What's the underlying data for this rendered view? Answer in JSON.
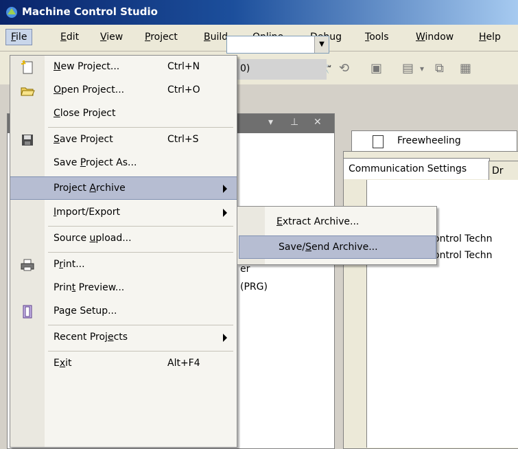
{
  "window": {
    "title": "Machine Control Studio"
  },
  "menubar": {
    "items": [
      {
        "label_u": "F",
        "label_rest": "ile"
      },
      {
        "label_u": "E",
        "label_rest": "dit"
      },
      {
        "label_u": "V",
        "label_rest": "iew"
      },
      {
        "label_u": "P",
        "label_rest": "roject"
      },
      {
        "label_u": "B",
        "label_rest": "uild"
      },
      {
        "label_u": "O",
        "label_rest": "nline"
      },
      {
        "label_u": "D",
        "label_rest": "ebug"
      },
      {
        "label_u": "T",
        "label_rest": "ools"
      },
      {
        "label_u": "W",
        "label_rest": "indow"
      },
      {
        "label_u": "H",
        "label_rest": "elp"
      }
    ]
  },
  "file_menu": {
    "new_project": {
      "u": "N",
      "rest": "ew Project...",
      "shortcut": "Ctrl+N"
    },
    "open_project": {
      "u": "O",
      "rest": "pen Project...",
      "shortcut": "Ctrl+O"
    },
    "close_project": {
      "u": "C",
      "rest": "lose Project"
    },
    "save_project": {
      "u": "S",
      "rest": "ave Project",
      "shortcut": "Ctrl+S"
    },
    "save_project_as": {
      "pre": "Save ",
      "u": "P",
      "rest": "roject As..."
    },
    "project_archive": {
      "pre": "Project ",
      "u": "A",
      "rest": "rchive"
    },
    "import_export": {
      "u": "I",
      "rest": "mport/Export"
    },
    "source_upload": {
      "pre": "Source ",
      "u": "u",
      "rest": "pload..."
    },
    "print": {
      "pre": "P",
      "u": "r",
      "rest": "int..."
    },
    "print_preview": {
      "pre": "Prin",
      "u": "t",
      "rest": " Preview..."
    },
    "page_setup": {
      "pre": "Pa",
      "u": "g",
      "rest": "e Setup..."
    },
    "recent_projects": {
      "pre": "Recent Proj",
      "u": "e",
      "rest": "cts"
    },
    "exit": {
      "pre": "E",
      "u": "x",
      "rest": "it",
      "shortcut": "Alt+F4"
    }
  },
  "archive_submenu": {
    "extract": {
      "u": "E",
      "rest": "xtract Archive..."
    },
    "save_send": {
      "pre": "Save/",
      "u": "S",
      "rest": "end Archive..."
    }
  },
  "left_panel": {
    "row_text": "0)",
    "frag1": "er",
    "frag2": "(PRG)"
  },
  "document": {
    "tab_label": "Freewheeling",
    "subtab1": "Communication Settings",
    "subtab2": "Dr",
    "line1": "ontrol Techn",
    "line2": "ontrol Techn"
  },
  "colors": {
    "titlebar_start": "#0a246a",
    "highlight": "#b6bdd2"
  }
}
